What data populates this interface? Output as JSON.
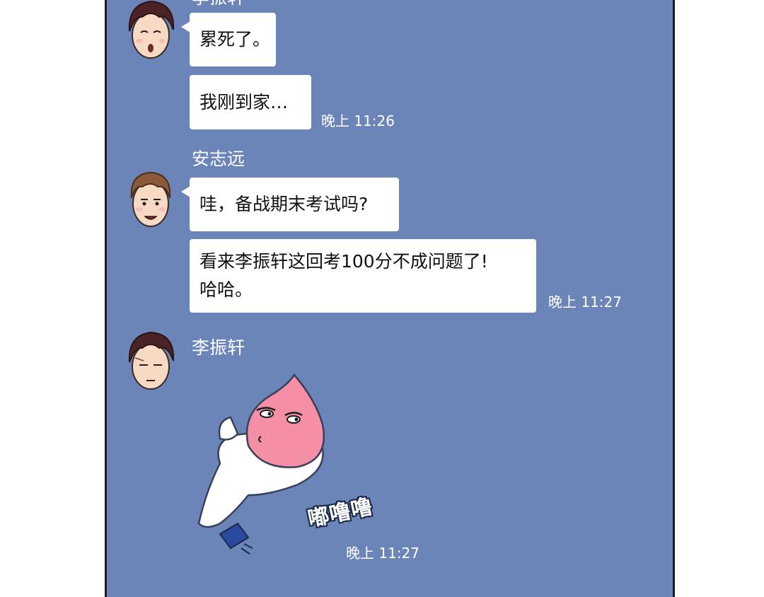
{
  "chat": {
    "top_sender_partial": "李振轩",
    "messages": [
      {
        "text": "累死了。"
      },
      {
        "text": "我刚到家…",
        "time": "晚上 11:26"
      },
      {
        "sender": "安志远",
        "text": "哇，备战期末考试吗?"
      },
      {
        "text_line1": "看来李振轩这回考100分不成问题了!",
        "text_line2": "哈哈。",
        "time": "晚上 11:27"
      },
      {
        "sender": "李振轩",
        "sticker_sound": "嘟噜噜",
        "time": "晚上 11:27"
      }
    ]
  },
  "colors": {
    "panel_bg": "#6b85b8",
    "bubble_bg": "#ffffff",
    "border": "#1c1c1c"
  },
  "icons": [
    "avatar-li-zhenxuan-icon",
    "avatar-an-zhiyuan-icon",
    "peach-sticker-icon"
  ]
}
